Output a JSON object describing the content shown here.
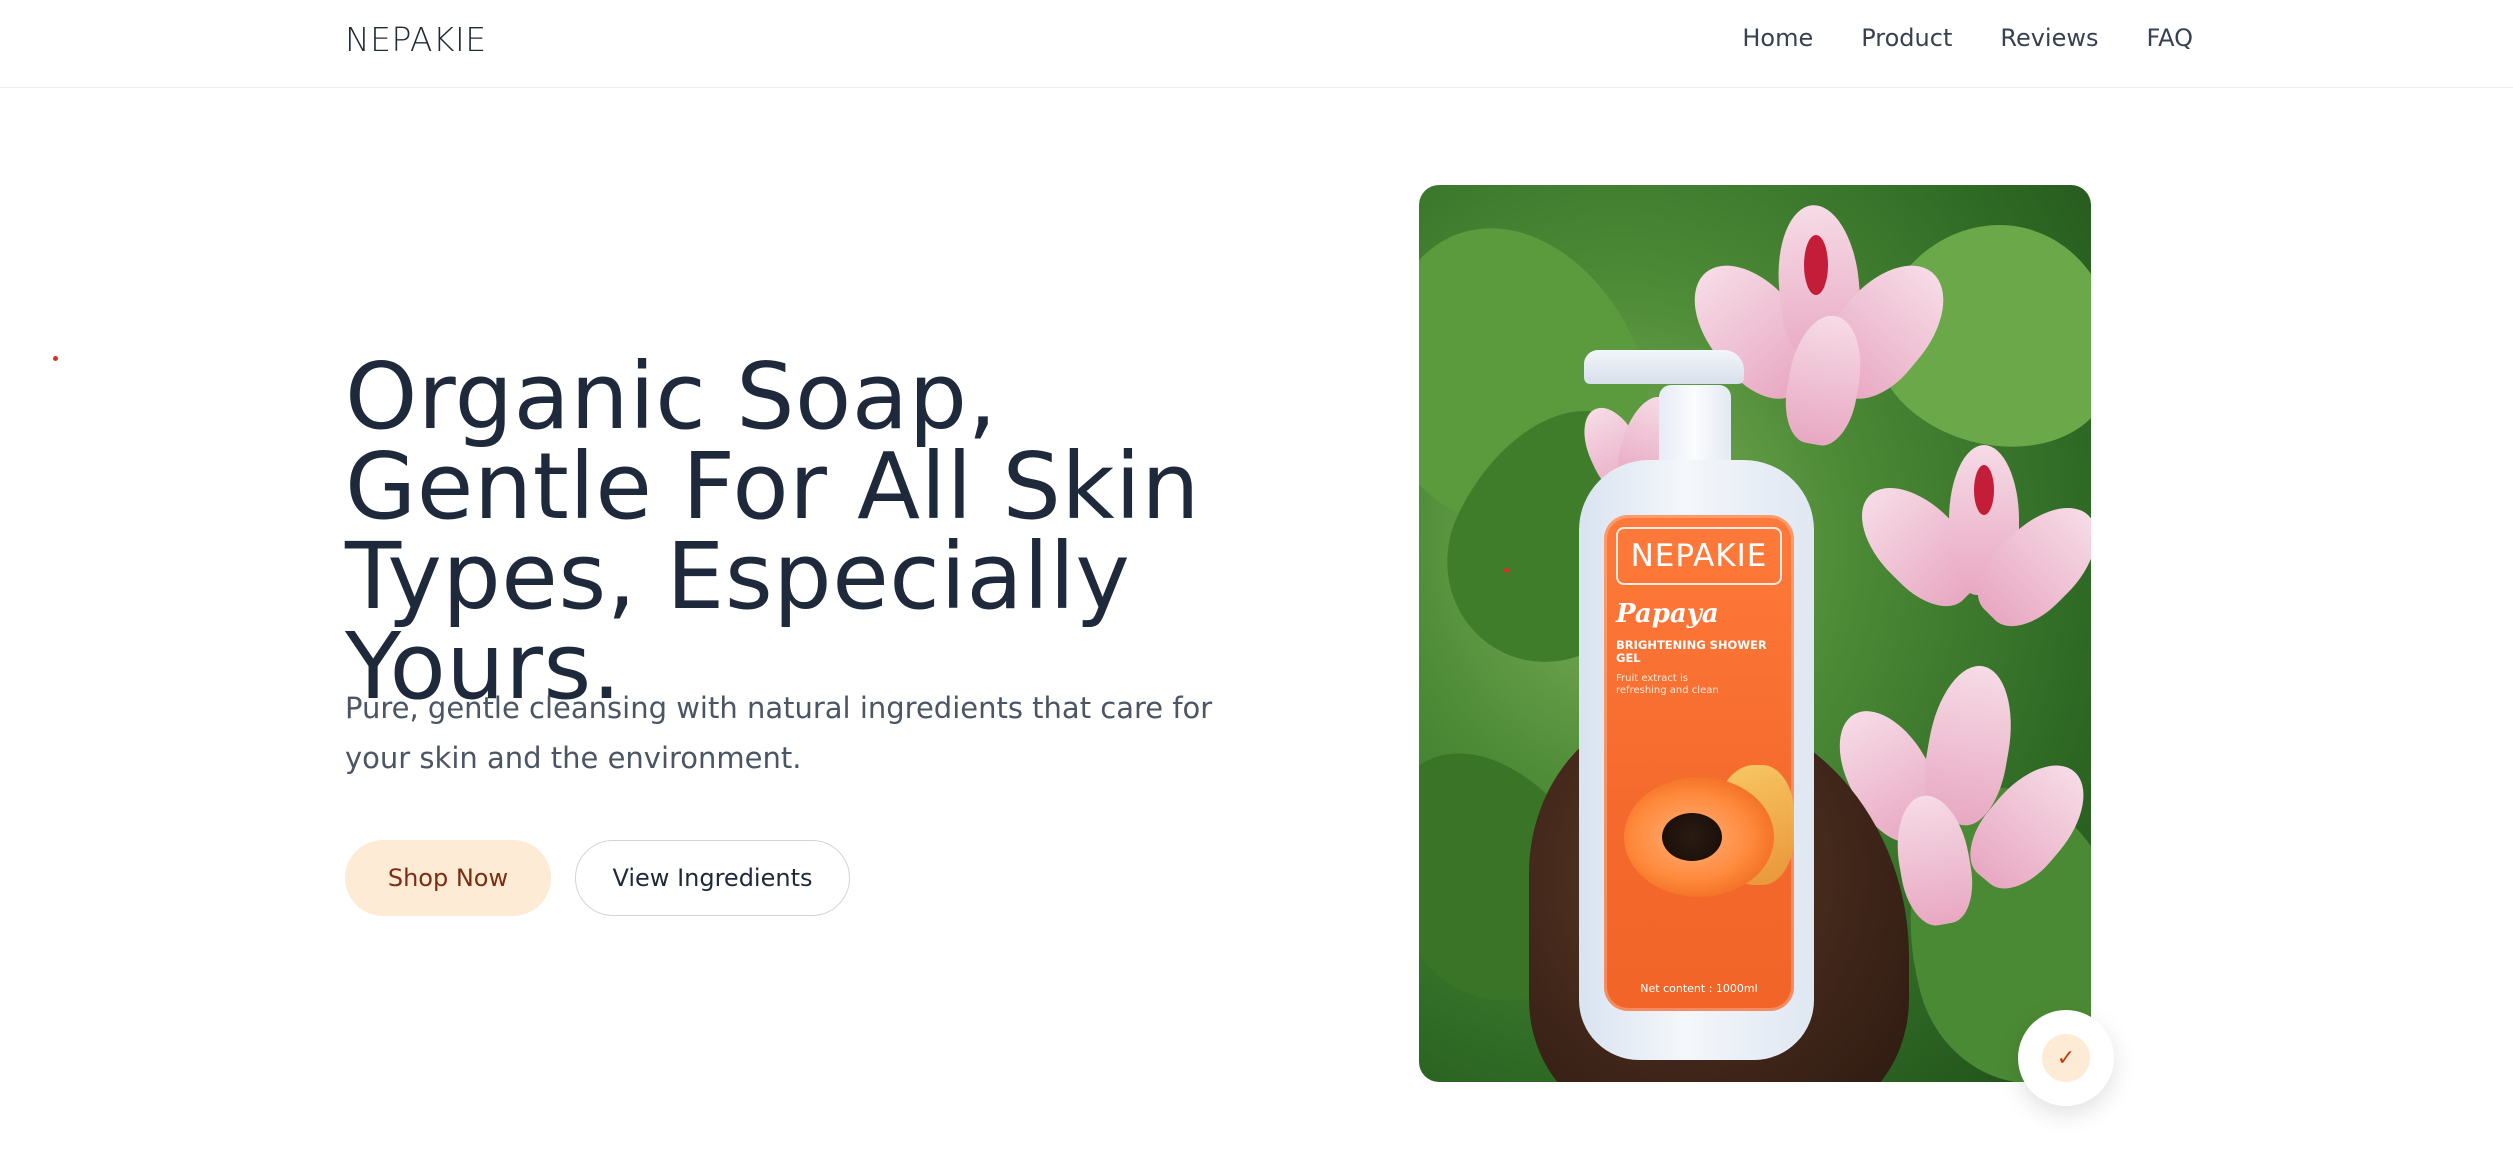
{
  "brand": "NEPAKIE",
  "nav": {
    "items": [
      {
        "label": "Home"
      },
      {
        "label": "Product"
      },
      {
        "label": "Reviews"
      },
      {
        "label": "FAQ"
      }
    ]
  },
  "hero": {
    "title": "Organic Soap, Gentle For All Skin Types, Especially Yours.",
    "subtitle": "Pure, gentle cleansing with natural ingredients that care for your skin and the environment.",
    "primary_button": "Shop Now",
    "secondary_button": "View Ingredients"
  },
  "product_image": {
    "label_brand": "NEPAKIE",
    "flavor": "Papaya",
    "type": "BRIGHTENING SHOWER GEL",
    "description": "Fruit extract is refreshing and clean",
    "net_content": "Net content : 1000ml"
  },
  "badge": {
    "icon": "check-icon",
    "glyph": "✓"
  },
  "colors": {
    "accent_bg": "#fdebd6",
    "accent_text": "#7c2d12",
    "title": "#1e293b",
    "body": "#4b5563"
  }
}
